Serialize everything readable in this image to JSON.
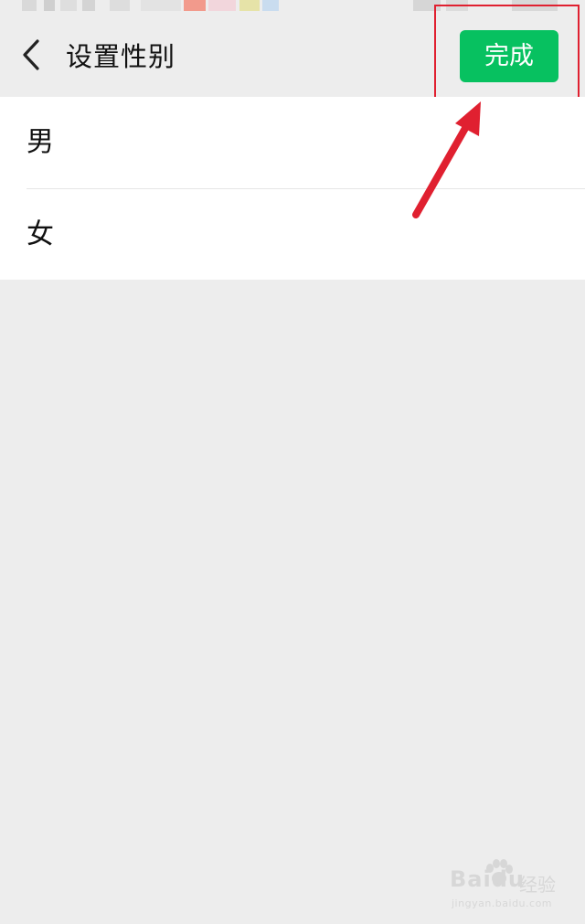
{
  "header": {
    "title": "设置性别",
    "done_label": "完成"
  },
  "options": [
    {
      "label": "男"
    },
    {
      "label": "女"
    }
  ],
  "watermark": {
    "brand": "Baidu",
    "sub": "经验",
    "url": "jingyan.baidu.com"
  },
  "colors": {
    "background": "#ededed",
    "surface": "#ffffff",
    "accent_green": "#07c160",
    "annotation_red": "#e02030",
    "text": "#111111"
  },
  "icons": {
    "back": "chevron-left-icon",
    "annotation": "red-arrow-icon",
    "watermark_logo": "paw-icon"
  }
}
